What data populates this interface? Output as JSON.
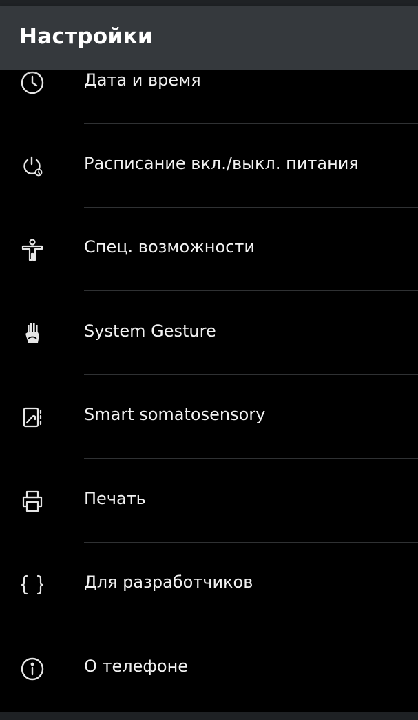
{
  "app_bar": {
    "title": "Настройки"
  },
  "settings_items": [
    {
      "label": "Дата и время",
      "icon": "clock-icon"
    },
    {
      "label": "Расписание вкл./выкл. питания",
      "icon": "power-schedule-icon"
    },
    {
      "label": "Спец. возможности",
      "icon": "accessibility-icon"
    },
    {
      "label": "System Gesture",
      "icon": "gesture-hand-icon"
    },
    {
      "label": "Smart somatosensory",
      "icon": "somatosensory-icon"
    },
    {
      "label": "Печать",
      "icon": "printer-icon"
    },
    {
      "label": "Для разработчиков",
      "icon": "developer-braces-icon"
    },
    {
      "label": "О телефоне",
      "icon": "info-icon"
    }
  ],
  "colors": {
    "app_bar": "#35393d",
    "background": "#000000",
    "text": "#f2f2f2",
    "divider": "#2f3133"
  }
}
